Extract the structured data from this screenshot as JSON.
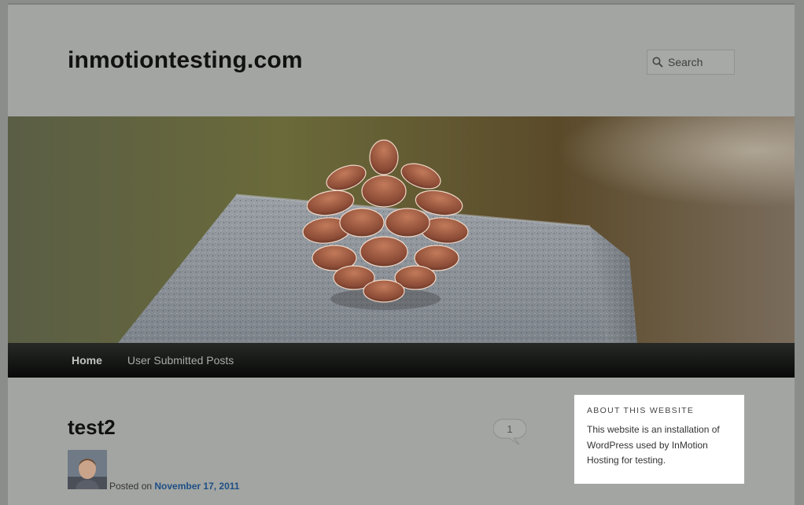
{
  "site": {
    "title": "inmotiontesting.com"
  },
  "search": {
    "placeholder": "Search",
    "icon": "search-icon"
  },
  "nav": {
    "items": [
      {
        "label": "Home",
        "active": true
      },
      {
        "label": "User Submitted Posts",
        "active": false
      }
    ]
  },
  "post": {
    "title": "test2",
    "comment_count": "1",
    "posted_on_label": "Posted on",
    "date": "November 17, 2011"
  },
  "widget": {
    "title": "ABOUT THIS WEBSITE",
    "text": "This website is an installation of WordPress used by InMotion Hosting for testing."
  },
  "colors": {
    "page_bg": "#a3a5a2",
    "nav_bg": "#0f100f",
    "link": "#1e4f86",
    "widget_bg": "#ffffff"
  }
}
